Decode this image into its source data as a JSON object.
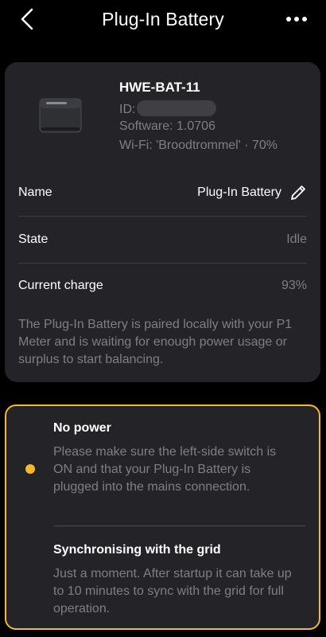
{
  "header": {
    "title": "Plug-In Battery",
    "back_icon": "chevron-left-icon",
    "more_icon": "more-horizontal-icon"
  },
  "device": {
    "name": "HWE-BAT-11",
    "id_label": "ID:",
    "software": "Software: 1.0706",
    "wifi": "Wi-Fi: 'Broodtrommel' · 70%"
  },
  "details": {
    "name_label": "Name",
    "name_value": "Plug-In Battery",
    "state_label": "State",
    "state_value": "Idle",
    "charge_label": "Current charge",
    "charge_value": "93%"
  },
  "description": "The Plug-In Battery is paired locally with your P1 Meter and is waiting for enough power usage or surplus to start balancing.",
  "status": {
    "items": [
      {
        "title": "No power",
        "text": "Please make sure the left-side switch is ON and that your Plug-In Battery is plugged into the mains connection."
      },
      {
        "title": "Synchronising with the grid",
        "text": "Just a moment. After startup it can take up to 10 minutes to sync with the grid for full operation."
      }
    ]
  },
  "colors": {
    "background": "#000000",
    "card": "#242428",
    "muted_text": "#7e7e84",
    "warning_accent": "#f5b82e"
  }
}
